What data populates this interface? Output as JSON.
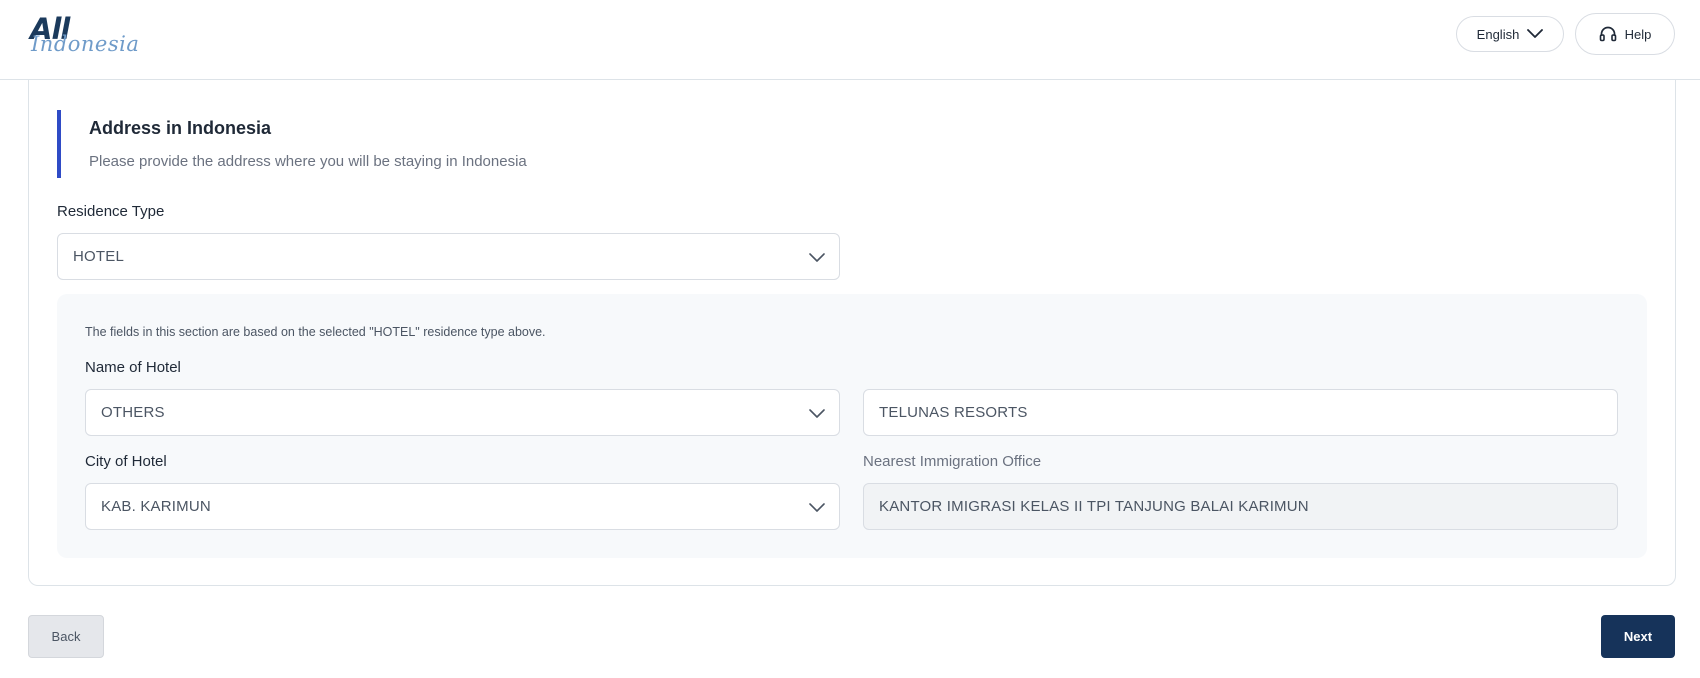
{
  "header": {
    "logo_primary": "All",
    "logo_secondary": "Indonesia",
    "language_label": "English",
    "help_label": "Help"
  },
  "section": {
    "title": "Address in Indonesia",
    "subtitle": "Please provide the address where you will be staying in Indonesia",
    "accent_color": "#2f4bc6"
  },
  "form": {
    "residence_type_label": "Residence Type",
    "residence_type_value": "HOTEL",
    "hint": "The fields in this section are based on the selected \"HOTEL\" residence type above.",
    "hotel_name_label": "Name of Hotel",
    "hotel_name_select_value": "OTHERS",
    "hotel_name_other_value": "TELUNAS RESORTS",
    "city_label": "City of Hotel",
    "city_value": "KAB. KARIMUN",
    "immigration_label": "Nearest Immigration Office",
    "immigration_value": "KANTOR IMIGRASI KELAS II TPI TANJUNG BALAI KARIMUN"
  },
  "footer": {
    "back_label": "Back",
    "next_label": "Next",
    "primary_color": "#16335a"
  },
  "icons": {
    "language_chevron": "chevron-down-icon",
    "help": "headset-icon",
    "select_chevron": "chevron-down-icon"
  }
}
